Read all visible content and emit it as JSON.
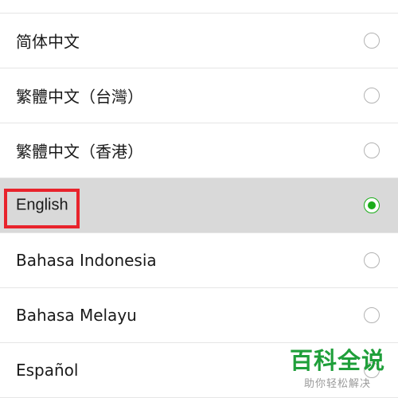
{
  "languages": [
    {
      "label": "简体中文",
      "selected": false
    },
    {
      "label": "繁體中文（台灣）",
      "selected": false
    },
    {
      "label": "繁體中文（香港）",
      "selected": false
    },
    {
      "label": "English",
      "selected": true
    },
    {
      "label": "Bahasa Indonesia",
      "selected": false
    },
    {
      "label": "Bahasa Melayu",
      "selected": false
    },
    {
      "label": "Español",
      "selected": false
    }
  ],
  "watermark": {
    "title": "百科全说",
    "subtitle": "助你轻松解决"
  },
  "colors": {
    "selected_row_bg": "#d9d9d9",
    "radio_checked": "#1aad19",
    "radio_unchecked": "#b3b3b3",
    "highlight_box": "#e8232c",
    "watermark_green": "#1f9f3a"
  },
  "icons": {
    "radio_unchecked": "radio-unchecked-icon",
    "radio_checked": "radio-checked-icon"
  }
}
